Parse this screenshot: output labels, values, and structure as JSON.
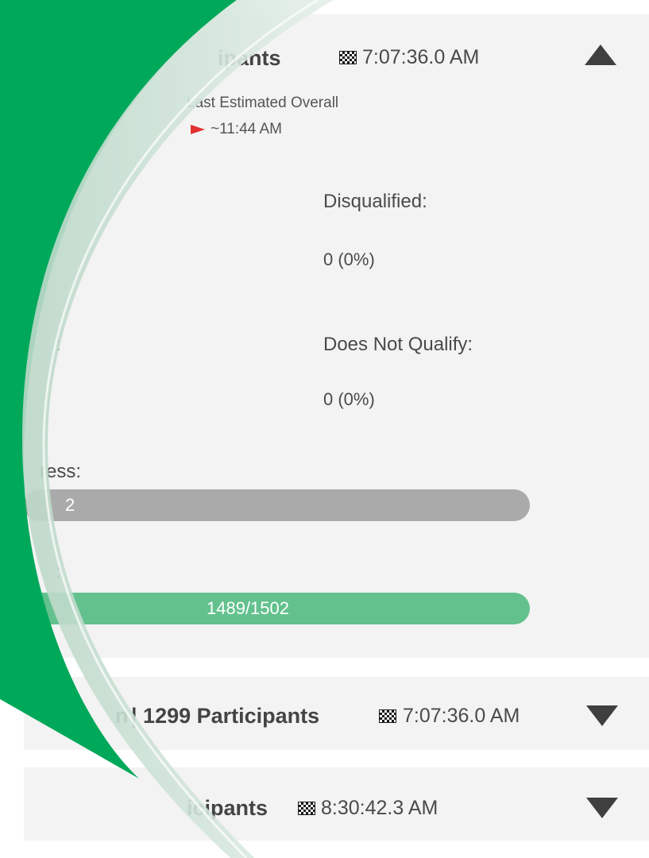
{
  "sections": [
    {
      "title": "ipants",
      "finish_time": "7:07:36.0 AM",
      "estimate_label": "Last Estimated Overall",
      "estimate_value": "~11:44 AM",
      "disqualified_label": "Disqualified:",
      "disqualified_value": "0 (0%)",
      "dnq_partial_label": ":",
      "dnq_label": "Does Not Qualify:",
      "dnq_value": "0 (0%)",
      "progress_label": "ress:",
      "progress_bar_text": "2",
      "progress_fraction": 1.0,
      "finished_label": ":",
      "finished_bar_text": "1489/1502",
      "finished_fraction": 0.9913,
      "expanded": true
    },
    {
      "title": "| 1299 Participants",
      "partial_prefix": "n",
      "finish_time": "7:07:36.0 AM",
      "expanded": false
    },
    {
      "title": "icipants",
      "finish_time": "8:30:42.3 AM",
      "expanded": false
    }
  ],
  "colors": {
    "panel_bg": "#f3f3f3",
    "accent_green": "#00a85a",
    "bar_green": "#63c18e",
    "bar_gray": "#aaaaaa",
    "flag_red": "#e03030"
  },
  "icons": [
    "checkered-flag-icon",
    "red-flag-icon",
    "triangle-up-icon",
    "triangle-down-icon"
  ]
}
